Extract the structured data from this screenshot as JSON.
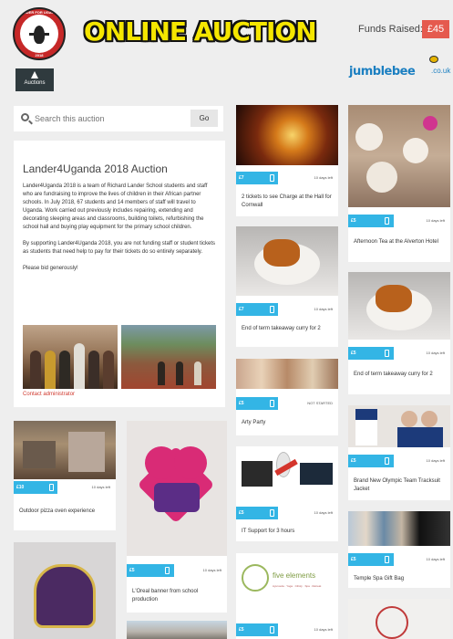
{
  "header": {
    "logo_top": "LANDER FOR UGANDA",
    "logo_bottom": "2018",
    "title": "ONLINE AUCTION",
    "funds_label": "Funds Raised:",
    "funds_value": "£45",
    "partner": "jumblebee",
    "partner_tld": ".co.uk"
  },
  "nav": {
    "tab_label": "Auctions"
  },
  "search": {
    "placeholder": "Search this auction",
    "button": "Go"
  },
  "info": {
    "title": "Lander4Uganda 2018 Auction",
    "p1": "Lander4Uganda 2018 is a team of Richard Lander School students and staff who are fundraising to improve the lives of children in their African partner schools. In July 2018, 67 students and 14 members of staff will travel to Uganda. Work carried out previously includes repairing, extending and decorating sleeping areas and classrooms, building toilets, refurbishing the school hall and buying play equipment for the primary school children.",
    "p2": "By supporting Lander4Uganda 2018, you are not funding staff or student tickets as students that need help to pay for their tickets do so entirely separately.",
    "p3": "Please bid generously!",
    "contact": "Contact administrator"
  },
  "items": [
    {
      "price": "£7",
      "days": "10 days left",
      "title": "2 tickets to see Charge at the Hall for Cornwall"
    },
    {
      "price": "£7",
      "days": "10 days left",
      "title": "End of term takeaway curry for 2"
    },
    {
      "price": "£5",
      "days": "NOT STARTED",
      "title": "Arty Party"
    },
    {
      "price": "£5",
      "days": "10 days left",
      "title": "IT Support for 3 hours"
    },
    {
      "price": "£5",
      "days": "10 days left",
      "title": ""
    },
    {
      "price": "£5",
      "days": "10 days left",
      "title": "Afternoon Tea at the Alverton Hotel"
    },
    {
      "price": "£5",
      "days": "10 days left",
      "title": "End of term takeaway curry for 2"
    },
    {
      "price": "£5",
      "days": "10 days left",
      "title": "Brand New Olympic Team Tracksuit Jacket"
    },
    {
      "price": "£5",
      "days": "10 days left",
      "title": "Temple Spa Gift Bag"
    },
    {
      "price": "£10",
      "days": "10 days left",
      "title": "Outdoor pizza oven experience"
    },
    {
      "price": "£5",
      "days": "10 days left",
      "title": "L'Oreal banner from school production"
    }
  ],
  "five_elements": {
    "name": "five elements",
    "tagline": "Ayurveda · Yoga · Cihsly · Spa · Retreat"
  }
}
